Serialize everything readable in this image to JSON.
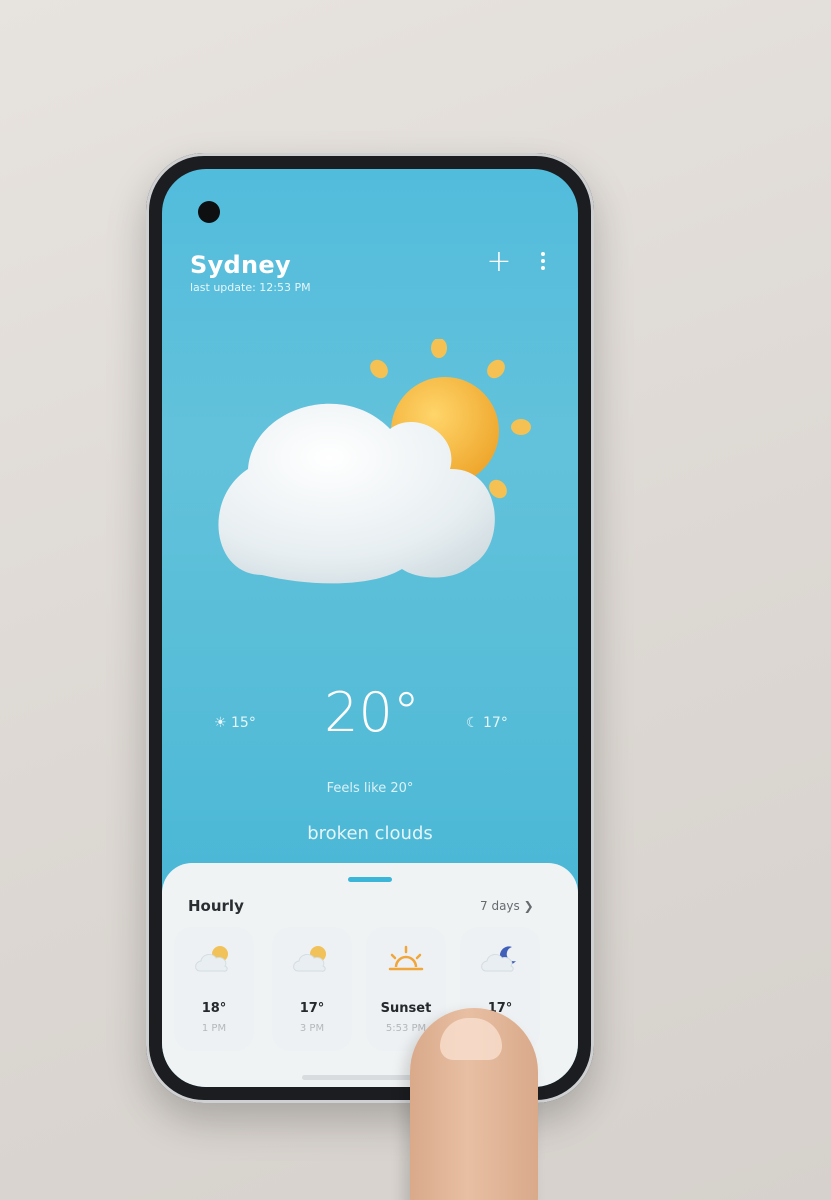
{
  "header": {
    "city": "Sydney",
    "last_updated": "last update: 12:53 PM"
  },
  "icons": {
    "add": "plus-icon",
    "more": "more-vertical-icon",
    "hero": "partly-cloudy-icon",
    "sun_small": "sun-icon",
    "moon_small": "moon-icon"
  },
  "current": {
    "low": "15°",
    "temperature": "20°",
    "night": "17°",
    "feels_like": "Feels like 20°",
    "description": "broken clouds"
  },
  "hourly": {
    "title": "Hourly",
    "days_link": "7 days ❯",
    "items": [
      {
        "temp": "18°",
        "time": "1 PM",
        "icon": "partly-cloudy-icon"
      },
      {
        "temp": "17°",
        "time": "3 PM",
        "icon": "partly-cloudy-icon"
      },
      {
        "temp": "Sunset",
        "time": "5:53 PM",
        "icon": "sunset-icon"
      },
      {
        "temp": "17°",
        "time": "7 PM",
        "icon": "partly-cloudy-night-icon"
      }
    ]
  },
  "colors": {
    "sky_top": "#52bcdc",
    "sky_bottom": "#3eb2d6",
    "accent": "#3bb5d8",
    "sun": "#f5b83a"
  }
}
